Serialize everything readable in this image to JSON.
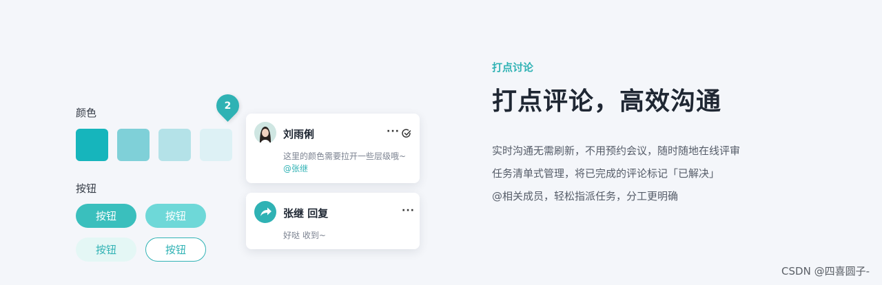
{
  "colors": {
    "accent": "#2fb2b4",
    "swatches": [
      "#16b5bc",
      "#7fd0d8",
      "#b4e2e8",
      "#ddf1f5"
    ],
    "button_solid": "#3abfbd",
    "button_light": "#6ed8d8",
    "button_pale": "#e4f7f5"
  },
  "left": {
    "color_label": "颜色",
    "button_label": "按钮",
    "buttons": [
      "按钮",
      "按钮",
      "按钮",
      "按钮"
    ]
  },
  "pin": {
    "number": "2"
  },
  "comment": {
    "author": "刘雨俐",
    "text": "这里的颜色需要拉开一些层级哦~",
    "mention": "@张继",
    "more_icon": "ellipsis-icon",
    "resolve_icon": "check-circle-icon"
  },
  "reply": {
    "author_action": "张继 回复",
    "text": "好哒 收到~",
    "icon": "reply-arrow-icon",
    "more_icon": "ellipsis-icon"
  },
  "feature": {
    "eyebrow": "打点讨论",
    "title": "打点评论，高效沟通",
    "lines": [
      "实时沟通无需刷新，不用预约会议，随时随地在线评审",
      "任务清单式管理，将已完成的评论标记「已解决」",
      "@相关成员，轻松指派任务，分工更明确"
    ]
  },
  "watermark": "CSDN @四喜圆子-"
}
